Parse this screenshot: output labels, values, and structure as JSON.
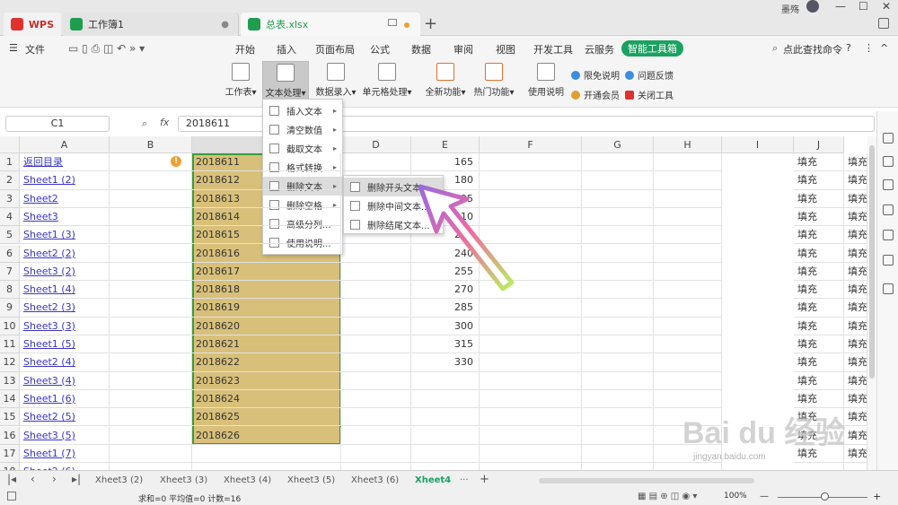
{
  "titlebar": {
    "wps_label": "WPS",
    "tab1": "工作簿1",
    "tab2": "总表.xlsx",
    "add": "+",
    "user": "墨殇"
  },
  "menubar": [
    "文件",
    "开始",
    "插入",
    "页面布局",
    "公式",
    "数据",
    "审阅",
    "视图",
    "开发工具",
    "云服务",
    "智能工具箱"
  ],
  "search_label": "点此查找命令",
  "ribbon": {
    "sheet": "工作表",
    "text": "文本处理",
    "data": "数据录入",
    "cell": "单元格处理",
    "all": "全新功能",
    "hot": "热门功能",
    "help": "使用说明",
    "free": "限免说明",
    "feedback": "问题反馈",
    "member": "开通会员",
    "close": "关闭工具"
  },
  "formula": {
    "cell": "C1",
    "fx": "fx",
    "value": "2018611"
  },
  "columns": [
    "A",
    "B",
    "C",
    "D",
    "E",
    "F",
    "G",
    "H",
    "I",
    "J"
  ],
  "rows": [
    "1",
    "2",
    "3",
    "4",
    "5",
    "6",
    "7",
    "8",
    "9",
    "10",
    "11",
    "12",
    "13",
    "14",
    "15",
    "16",
    "17",
    "18"
  ],
  "colA": [
    "返回目录",
    "Sheet1 (2)",
    "Sheet2",
    "Sheet3",
    "Sheet1 (3)",
    "Sheet2 (2)",
    "Sheet3 (2)",
    "Sheet1 (4)",
    "Sheet2 (3)",
    "Sheet3 (3)",
    "Sheet1 (5)",
    "Sheet2 (4)",
    "Sheet3 (4)",
    "Sheet1 (6)",
    "Sheet2 (5)",
    "Sheet3 (5)",
    "Sheet1 (7)",
    "Sheet2 (6)"
  ],
  "colC": [
    "2018611",
    "2018612",
    "2018613",
    "2018614",
    "2018615",
    "2018616",
    "2018617",
    "2018618",
    "2018619",
    "2018620",
    "2018621",
    "2018622",
    "2018623",
    "2018624",
    "2018625",
    "2018626"
  ],
  "colE": [
    "165",
    "180",
    "195",
    "210",
    "225",
    "240",
    "255",
    "270",
    "285",
    "300",
    "315",
    "330"
  ],
  "fill": "填充",
  "fill_partial": "填充",
  "dropdown": [
    "插入文本",
    "清空数值",
    "截取文本",
    "格式转换",
    "删除文本",
    "删除空格",
    "高级分列...",
    "使用说明..."
  ],
  "submenu": [
    "删除开头文本...",
    "删除中间文本...",
    "删除结尾文本..."
  ],
  "sheets": [
    "Xheet3 (2)",
    "Xheet3 (3)",
    "Xheet3 (4)",
    "Xheet3 (5)",
    "Xheet3 (6)",
    "Xheet4"
  ],
  "status": {
    "text": "求和=0  平均值=0  计数=16",
    "zoom": "100%"
  },
  "watermark": "Bai du 经验",
  "watermark_url": "jingyan.baidu.com",
  "colors": {
    "accent": "#1aa260",
    "selection": "#d8c07a",
    "border": "#3b9d3b"
  }
}
